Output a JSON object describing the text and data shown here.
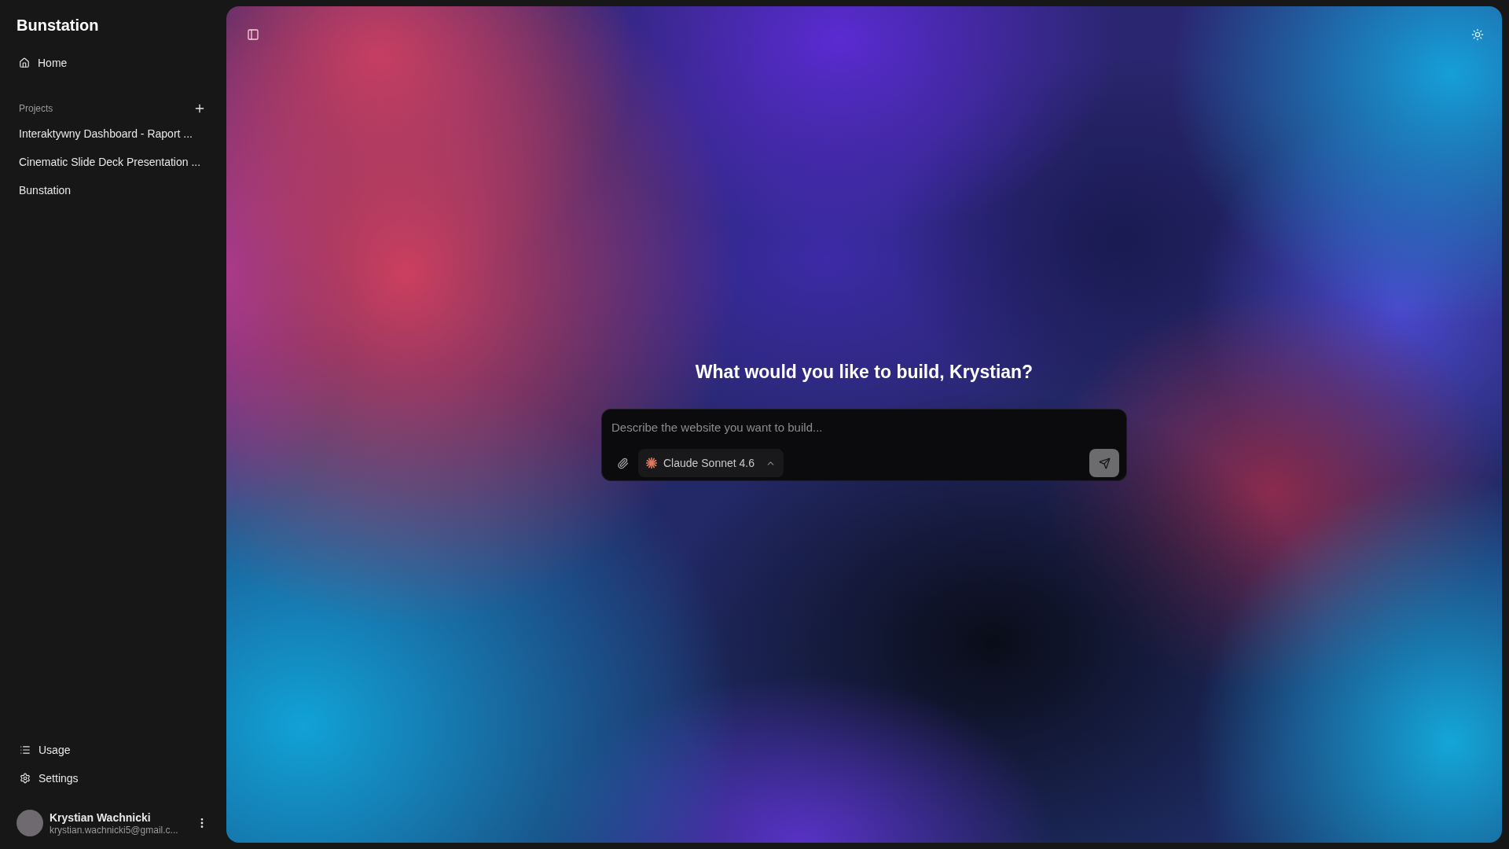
{
  "sidebar": {
    "title": "Bunstation",
    "home_link": "Home",
    "projects_heading": "Projects",
    "projects": [
      "Interaktywny Dashboard - Raport ...",
      "Cinematic Slide Deck Presentation ...",
      "Bunstation"
    ],
    "usage_link": "Usage",
    "settings_link": "Settings",
    "user": {
      "name": "Krystian Wachnicki",
      "email": "krystian.wachnicki5@gmail.c..."
    }
  },
  "main": {
    "heading": "What would you like to build, Krystian?",
    "prompt": {
      "placeholder": "Describe the website you want to build...",
      "model": "Claude Sonnet 4.6"
    }
  }
}
